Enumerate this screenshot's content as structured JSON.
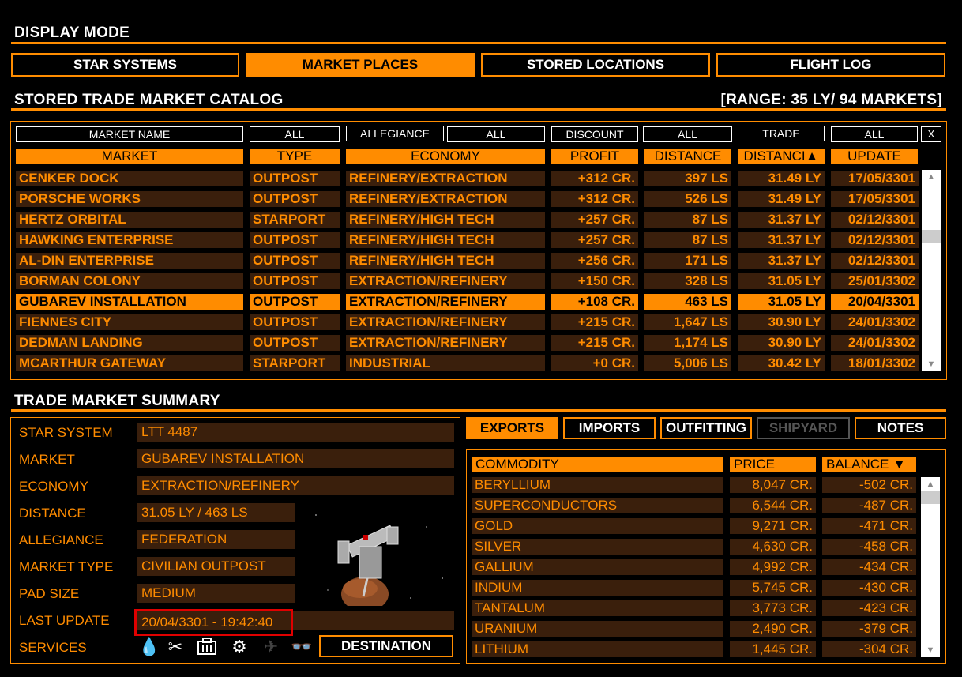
{
  "display_mode": {
    "title": "DISPLAY MODE",
    "buttons": [
      "STAR SYSTEMS",
      "MARKET PLACES",
      "STORED LOCATIONS",
      "FLIGHT LOG"
    ]
  },
  "catalog": {
    "title": "STORED TRADE MARKET CATALOG",
    "range": "[RANGE: 35 LY/ 94 MARKETS]",
    "filters": [
      "MARKET NAME",
      "ALL",
      "ALLEGIANCE",
      "ALL",
      "DISCOUNT",
      "ALL",
      "TRADE",
      "ALL",
      "X"
    ],
    "columns": [
      "MARKET",
      "TYPE",
      "ECONOMY",
      "PROFIT",
      "DISTANCE",
      "DISTANCI▲",
      "UPDATE"
    ],
    "rows": [
      {
        "market": "CENKER DOCK",
        "type": "OUTPOST",
        "economy": "REFINERY/EXTRACTION",
        "profit": "+312 CR.",
        "distance": "397 LS",
        "ly": "31.49 LY",
        "update": "17/05/3301"
      },
      {
        "market": "PORSCHE WORKS",
        "type": "OUTPOST",
        "economy": "REFINERY/EXTRACTION",
        "profit": "+312 CR.",
        "distance": "526 LS",
        "ly": "31.49 LY",
        "update": "17/05/3301"
      },
      {
        "market": "HERTZ ORBITAL",
        "type": "STARPORT",
        "economy": "REFINERY/HIGH TECH",
        "profit": "+257 CR.",
        "distance": "87 LS",
        "ly": "31.37 LY",
        "update": "02/12/3301"
      },
      {
        "market": "HAWKING ENTERPRISE",
        "type": "OUTPOST",
        "economy": "REFINERY/HIGH TECH",
        "profit": "+257 CR.",
        "distance": "87 LS",
        "ly": "31.37 LY",
        "update": "02/12/3301"
      },
      {
        "market": "AL-DIN ENTERPRISE",
        "type": "OUTPOST",
        "economy": "REFINERY/HIGH TECH",
        "profit": "+256 CR.",
        "distance": "171 LS",
        "ly": "31.37 LY",
        "update": "02/12/3301"
      },
      {
        "market": "BORMAN COLONY",
        "type": "OUTPOST",
        "economy": "EXTRACTION/REFINERY",
        "profit": "+150 CR.",
        "distance": "328 LS",
        "ly": "31.05 LY",
        "update": "25/01/3302"
      },
      {
        "market": "GUBAREV INSTALLATION",
        "type": "OUTPOST",
        "economy": "EXTRACTION/REFINERY",
        "profit": "+108 CR.",
        "distance": "463 LS",
        "ly": "31.05 LY",
        "update": "20/04/3301"
      },
      {
        "market": "FIENNES CITY",
        "type": "OUTPOST",
        "economy": "EXTRACTION/REFINERY",
        "profit": "+215 CR.",
        "distance": "1,647 LS",
        "ly": "30.90 LY",
        "update": "24/01/3302"
      },
      {
        "market": "DEDMAN LANDING",
        "type": "OUTPOST",
        "economy": "EXTRACTION/REFINERY",
        "profit": "+215 CR.",
        "distance": "1,174 LS",
        "ly": "30.90 LY",
        "update": "24/01/3302"
      },
      {
        "market": "MCARTHUR GATEWAY",
        "type": "STARPORT",
        "economy": "INDUSTRIAL",
        "profit": "+0 CR.",
        "distance": "5,006 LS",
        "ly": "30.42 LY",
        "update": "18/01/3302"
      }
    ]
  },
  "summary": {
    "title": "TRADE MARKET SUMMARY",
    "labels": [
      "STAR SYSTEM",
      "MARKET",
      "ECONOMY",
      "DISTANCE",
      "ALLEGIANCE",
      "MARKET TYPE",
      "PAD SIZE",
      "LAST UPDATE",
      "SERVICES"
    ],
    "star_system": "LTT 4487",
    "market": "GUBAREV INSTALLATION",
    "economy": "EXTRACTION/REFINERY",
    "distance": "31.05 LY / 463 LS",
    "allegiance": "FEDERATION",
    "market_type": "CIVILIAN OUTPOST",
    "pad_size": "MEDIUM",
    "last_update": "20/04/3301 - 19:42:40",
    "destination_button": "DESTINATION",
    "service_icons": [
      "refuel-icon",
      "repair-icon",
      "rearm-icon",
      "outfitting-icon",
      "shipyard-icon",
      "blackmarket-icon"
    ]
  },
  "tabs": [
    "EXPORTS",
    "IMPORTS",
    "OUTFITTING",
    "SHIPYARD",
    "NOTES"
  ],
  "commodities": {
    "columns": [
      "COMMODITY",
      "PRICE",
      "BALANCE ▼"
    ],
    "rows": [
      {
        "name": "BERYLLIUM",
        "price": "8,047 CR.",
        "balance": "-502 CR."
      },
      {
        "name": "SUPERCONDUCTORS",
        "price": "6,544 CR.",
        "balance": "-487 CR."
      },
      {
        "name": "GOLD",
        "price": "9,271 CR.",
        "balance": "-471 CR."
      },
      {
        "name": "SILVER",
        "price": "4,630 CR.",
        "balance": "-458 CR."
      },
      {
        "name": "GALLIUM",
        "price": "4,992 CR.",
        "balance": "-434 CR."
      },
      {
        "name": "INDIUM",
        "price": "5,745 CR.",
        "balance": "-430 CR."
      },
      {
        "name": "TANTALUM",
        "price": "3,773 CR.",
        "balance": "-423 CR."
      },
      {
        "name": "URANIUM",
        "price": "2,490 CR.",
        "balance": "-379 CR."
      },
      {
        "name": "LITHIUM",
        "price": "1,445 CR.",
        "balance": "-304 CR."
      }
    ]
  }
}
